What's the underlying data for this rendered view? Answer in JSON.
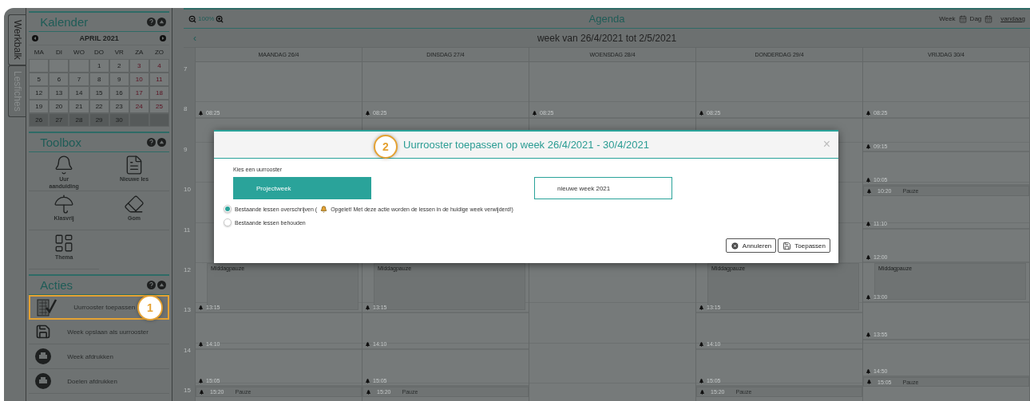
{
  "sidebar": {
    "tabs": [
      {
        "label": "Werkbalk",
        "selected": true
      },
      {
        "label": "Lesfiches",
        "selected": false
      }
    ],
    "calendar": {
      "title": "Kalender",
      "month": "APRIL 2021",
      "weekdays": [
        "MA",
        "DI",
        "WO",
        "DO",
        "VR",
        "ZA",
        "ZO"
      ],
      "weeks": [
        {
          "selected": false,
          "days": [
            {
              "kind": "blank"
            },
            {
              "kind": "blank"
            },
            {
              "kind": "blank"
            },
            {
              "kind": "day",
              "day": "1",
              "weekend": false
            },
            {
              "kind": "day",
              "day": "2",
              "weekend": false
            },
            {
              "kind": "day",
              "day": "3",
              "weekend": true
            },
            {
              "kind": "day",
              "day": "4",
              "weekend": true
            }
          ]
        },
        {
          "selected": false,
          "days": [
            {
              "kind": "day",
              "day": "5",
              "weekend": false
            },
            {
              "kind": "day",
              "day": "6",
              "weekend": false
            },
            {
              "kind": "day",
              "day": "7",
              "weekend": false
            },
            {
              "kind": "day",
              "day": "8",
              "weekend": false
            },
            {
              "kind": "day",
              "day": "9",
              "weekend": false
            },
            {
              "kind": "day",
              "day": "10",
              "weekend": true
            },
            {
              "kind": "day",
              "day": "11",
              "weekend": true
            }
          ]
        },
        {
          "selected": false,
          "days": [
            {
              "kind": "day",
              "day": "12",
              "weekend": false
            },
            {
              "kind": "day",
              "day": "13",
              "weekend": false
            },
            {
              "kind": "day",
              "day": "14",
              "weekend": false
            },
            {
              "kind": "day",
              "day": "15",
              "weekend": false
            },
            {
              "kind": "day",
              "day": "16",
              "weekend": false
            },
            {
              "kind": "day",
              "day": "17",
              "weekend": true
            },
            {
              "kind": "day",
              "day": "18",
              "weekend": true
            }
          ]
        },
        {
          "selected": false,
          "days": [
            {
              "kind": "day",
              "day": "19",
              "weekend": false
            },
            {
              "kind": "day",
              "day": "20",
              "weekend": false
            },
            {
              "kind": "day",
              "day": "21",
              "weekend": false
            },
            {
              "kind": "day",
              "day": "22",
              "weekend": false
            },
            {
              "kind": "day",
              "day": "23",
              "weekend": false
            },
            {
              "kind": "day",
              "day": "24",
              "weekend": true
            },
            {
              "kind": "day",
              "day": "25",
              "weekend": true
            }
          ]
        },
        {
          "selected": true,
          "days": [
            {
              "kind": "day",
              "day": "26",
              "weekend": false
            },
            {
              "kind": "day",
              "day": "27",
              "weekend": false
            },
            {
              "kind": "day",
              "day": "28",
              "weekend": false
            },
            {
              "kind": "day",
              "day": "29",
              "weekend": false
            },
            {
              "kind": "day",
              "day": "30",
              "weekend": false
            },
            {
              "kind": "blank"
            },
            {
              "kind": "blank"
            }
          ]
        }
      ]
    },
    "toolbox": {
      "title": "Toolbox",
      "tools": [
        {
          "label": "Uur aanduiding",
          "kind": "bell"
        },
        {
          "label": "Nieuwe les",
          "kind": "document"
        },
        {
          "label": "Klasvrij",
          "kind": "umbrella"
        },
        {
          "label": "Gom",
          "kind": "eraser"
        },
        {
          "label": "Thema",
          "kind": "layout"
        }
      ]
    },
    "actions": {
      "title": "Acties",
      "items": [
        {
          "label": "Uurrooster toepassen",
          "kind": "apply",
          "highlighted": true,
          "badge": "1"
        },
        {
          "label": "Week opslaan als uurrooster",
          "kind": "save",
          "highlighted": false
        },
        {
          "label": "Week afdrukken",
          "kind": "print",
          "highlighted": false
        },
        {
          "label": "Doelen afdrukken",
          "kind": "print",
          "highlighted": false
        }
      ]
    }
  },
  "agenda": {
    "zoom": "100%",
    "title": "Agenda",
    "views": [
      "Week",
      "Dag"
    ],
    "today_link": "vandaag",
    "prev": "‹",
    "week_title": "week van 26/4/2021 tot 2/5/2021",
    "hours": [
      "7",
      "8",
      "9",
      "10",
      "11",
      "12",
      "13",
      "14",
      "15"
    ],
    "days": [
      {
        "label": "MAANDAG 26/4",
        "slots": [
          {
            "kind": "lesson",
            "time": "08:25"
          },
          {
            "kind": "lunch",
            "time": "13:15",
            "label": "Middagpauze"
          },
          {
            "kind": "lesson",
            "time": "14:10"
          },
          {
            "kind": "lesson",
            "time": "15:05"
          },
          {
            "kind": "break",
            "time": "15:20",
            "label": "Pauze"
          }
        ]
      },
      {
        "label": "DINSDAG 27/4",
        "slots": [
          {
            "kind": "lesson",
            "time": "08:25"
          },
          {
            "kind": "lunch",
            "time": "13:15",
            "label": "Middagpauze"
          },
          {
            "kind": "lesson",
            "time": "14:10"
          },
          {
            "kind": "lesson",
            "time": "15:05"
          },
          {
            "kind": "break",
            "time": "15:20",
            "label": "Pauze"
          }
        ]
      },
      {
        "label": "WOENSDAG 28/4",
        "slots": [
          {
            "kind": "lesson",
            "time": "08:25"
          }
        ]
      },
      {
        "label": "DONDERDAG 29/4",
        "slots": [
          {
            "kind": "lesson",
            "time": "08:25"
          },
          {
            "kind": "lunch",
            "time": "13:15",
            "label": "Middagpauze"
          },
          {
            "kind": "lesson",
            "time": "14:10"
          },
          {
            "kind": "lesson",
            "time": "15:05"
          },
          {
            "kind": "break",
            "time": "15:20",
            "label": "Pauze"
          }
        ]
      },
      {
        "label": "VRIJDAG 30/4",
        "slots": [
          {
            "kind": "lesson",
            "time": "08:25"
          },
          {
            "kind": "lesson",
            "time": "09:15"
          },
          {
            "kind": "lesson",
            "time": "10:05"
          },
          {
            "kind": "break",
            "time": "10:20",
            "label": "Pauze"
          },
          {
            "kind": "lesson",
            "time": "11:10"
          },
          {
            "kind": "lesson",
            "time": "12:00"
          },
          {
            "kind": "lunch",
            "time": "13:00",
            "label": "Middagpauze"
          },
          {
            "kind": "lesson",
            "time": "13:55"
          },
          {
            "kind": "lesson",
            "time": "14:50"
          },
          {
            "kind": "break",
            "time": "15:05",
            "label": "Pauze"
          }
        ]
      }
    ]
  },
  "dialog": {
    "badge": "2",
    "title": "Uurrooster toepassen op week 26/4/2021 - 30/4/2021",
    "close": "×",
    "prompt": "Kies een uurrooster",
    "options": [
      {
        "label": "Projectweek",
        "selected": true
      },
      {
        "label": "nieuwe week 2021",
        "selected": false
      }
    ],
    "radios": [
      {
        "label": "Bestaande lessen overschrijven (",
        "note": "Opgelet! Met deze actie worden de lessen in de huidige week verwijderd!)",
        "selected": true
      },
      {
        "label": "Bestaande lessen behouden",
        "selected": false
      }
    ],
    "buttons": [
      {
        "label": "Annuleren",
        "kind": "cancel"
      },
      {
        "label": "Toepassen",
        "kind": "save"
      }
    ]
  }
}
